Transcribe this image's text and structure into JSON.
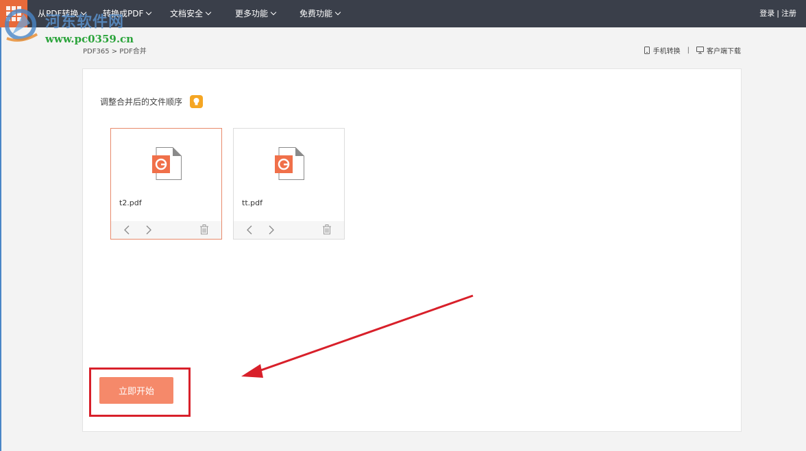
{
  "nav": {
    "items": [
      {
        "label": "从PDF转换"
      },
      {
        "label": "转换成PDF"
      },
      {
        "label": "文档安全"
      },
      {
        "label": "更多功能"
      },
      {
        "label": "免费功能"
      }
    ],
    "login": "登录",
    "separator": "|",
    "register": "注册"
  },
  "watermark": {
    "title": "河东软件网",
    "url": "www.pc0359.cn"
  },
  "breadcrumb": "PDF365  >  PDF合并",
  "top_links": {
    "mobile": "手机转换",
    "divider": "|",
    "client": "客户端下载"
  },
  "panel": {
    "hint": "调整合并后的文件顺序",
    "files": [
      {
        "name": "t2.pdf",
        "selected": true
      },
      {
        "name": "tt.pdf",
        "selected": false
      }
    ],
    "start_label": "立即开始"
  },
  "colors": {
    "topbar": "#3a3f4a",
    "accent": "#f5896a",
    "pdf_icon": "#f0704a",
    "annotation": "#d8202a"
  }
}
